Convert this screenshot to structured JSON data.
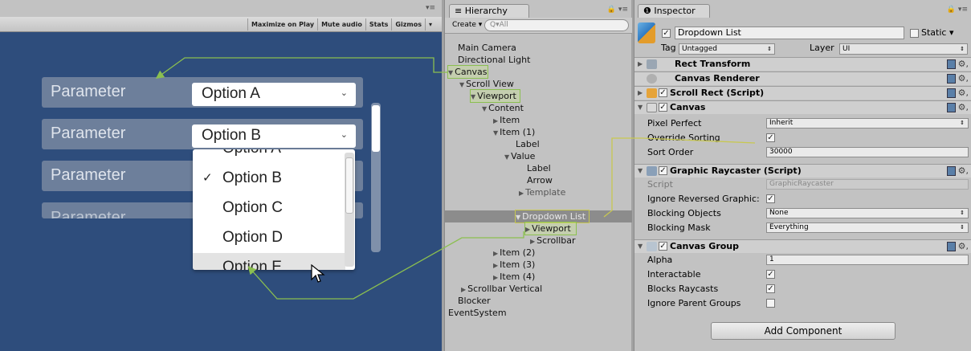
{
  "game": {
    "toolbar": [
      "Maximize on Play",
      "Mute audio",
      "Stats",
      "Gizmos"
    ],
    "tab_menu": "▾≡",
    "rows": [
      {
        "label": "Parameter",
        "value": "Option A"
      },
      {
        "label": "Parameter",
        "value": "Option B"
      },
      {
        "label": "Parameter",
        "value": ""
      },
      {
        "label": "Parameter",
        "value": ""
      }
    ],
    "dropdown_options": [
      {
        "label": "Option A",
        "checked": false
      },
      {
        "label": "Option B",
        "checked": true
      },
      {
        "label": "Option C",
        "checked": false
      },
      {
        "label": "Option D",
        "checked": false
      },
      {
        "label": "Option E",
        "checked": false
      }
    ],
    "check_glyph": "✓",
    "chevron": "⌄"
  },
  "hierarchy": {
    "tab": "≡ Hierarchy",
    "tab_menu": "🔒 ▾≡",
    "create": "Create ▾",
    "search_placeholder": "Q▾All",
    "nodes": [
      {
        "label": "Main Camera"
      },
      {
        "label": "Directional Light"
      },
      {
        "label": "Canvas"
      },
      {
        "label": "Scroll View"
      },
      {
        "label": "Viewport"
      },
      {
        "label": "Content"
      },
      {
        "label": "Item"
      },
      {
        "label": "Item (1)"
      },
      {
        "label": "Label"
      },
      {
        "label": "Value"
      },
      {
        "label": "Label"
      },
      {
        "label": "Arrow"
      },
      {
        "label": "Template"
      },
      {
        "label": "Dropdown List"
      },
      {
        "label": "Viewport"
      },
      {
        "label": "Scrollbar"
      },
      {
        "label": "Item (2)"
      },
      {
        "label": "Item (3)"
      },
      {
        "label": "Item (4)"
      },
      {
        "label": "Scrollbar Vertical"
      },
      {
        "label": "Blocker"
      },
      {
        "label": "EventSystem"
      }
    ]
  },
  "inspector": {
    "tab": "❶ Inspector",
    "tab_menu": "🔒 ▾≡",
    "object_name": "Dropdown List",
    "static_label": "Static ▾",
    "tag_label": "Tag",
    "tag_value": "Untagged",
    "layer_label": "Layer",
    "layer_value": "UI",
    "components": {
      "rect_transform": "Rect Transform",
      "canvas_renderer": "Canvas Renderer",
      "scroll_rect": "Scroll Rect (Script)",
      "canvas": "Canvas",
      "graphic_raycaster": "Graphic Raycaster (Script)",
      "canvas_group": "Canvas Group"
    },
    "canvas_props": {
      "pixel_perfect_label": "Pixel Perfect",
      "pixel_perfect_value": "Inherit",
      "override_sorting_label": "Override Sorting",
      "sort_order_label": "Sort Order",
      "sort_order_value": "30000"
    },
    "raycaster_props": {
      "script_label": "Script",
      "script_value": "GraphicRaycaster",
      "ignore_reversed_label": "Ignore Reversed Graphic:",
      "blocking_objects_label": "Blocking Objects",
      "blocking_objects_value": "None",
      "blocking_mask_label": "Blocking Mask",
      "blocking_mask_value": "Everything"
    },
    "group_props": {
      "alpha_label": "Alpha",
      "alpha_value": "1",
      "interactable_label": "Interactable",
      "blocks_raycasts_label": "Blocks Raycasts",
      "ignore_parent_label": "Ignore Parent Groups"
    },
    "add_component": "Add Component",
    "select_arrow": "⇕",
    "gear": "⚙,",
    "check": "✓"
  },
  "colors": {
    "game_bg": "#2e4d7c",
    "row_bg": "#6d7f9b",
    "arrow_green": "#8bbf50",
    "arrow_yellow": "#c8c850",
    "selection": "#8c8c8c"
  }
}
